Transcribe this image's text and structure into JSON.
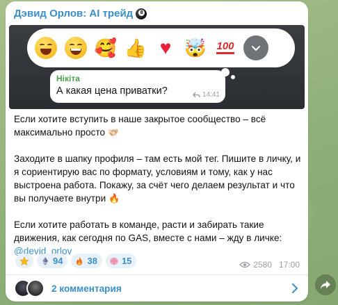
{
  "channel": {
    "name": "Дэвид Орлов: AI трейд"
  },
  "reaction_picker": {
    "emojis": [
      "😃",
      "😁",
      "🥰",
      "👍",
      "❤",
      "🤯",
      "💯"
    ]
  },
  "quote": {
    "author": "Нікіта",
    "text": "А какая цена приватки?",
    "time": "14:41"
  },
  "post": {
    "p1": "Если хотите вступить в наше закрытое сообщество – всё максимально просто",
    "p1_emoji": "🫱🏻‍🫲🏼",
    "p2": "Заходите в шапку профиля – там есть мой тег. Пишите в личку, и я сориентирую вас по формату, условиям и тому, как у нас выстроена работа. Покажу, за счёт чего делаем результат и что вы получаете внутри",
    "p2_emoji": "🔥",
    "p3": "Если хотите работать в команде, расти и забирать такие движения, как сегодня по GAS, вместе с нами – жду в личке:",
    "handle": "@devid_orlov"
  },
  "reactions": [
    {
      "icon": "star-icon",
      "count": ""
    },
    {
      "icon": "ethereum-icon",
      "count": "94"
    },
    {
      "icon": "fire-icon",
      "count": "38"
    },
    {
      "icon": "brain-icon",
      "count": "15"
    }
  ],
  "meta": {
    "views": "2580",
    "time": "17:00"
  },
  "comments": {
    "label": "2 комментария"
  },
  "colors": {
    "accent": "#3a8fc8",
    "quote_author": "#4aa04a",
    "bubble": "#ffffff"
  }
}
